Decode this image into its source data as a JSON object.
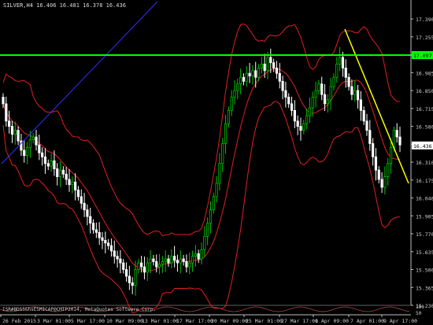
{
  "header": {
    "symbol_period": "SILVER,H4",
    "ohlc": "16.406 16.481 16.378 16.436"
  },
  "copyright": "ISR#BDS5&hsESMICAP@CMTP2014, MetaQuotes Software Corp.",
  "price_axis": {
    "ticks": [
      "17.390",
      "17.255",
      "17.120",
      "16.985",
      "16.850",
      "16.715",
      "16.580",
      "16.445",
      "16.310",
      "16.175",
      "16.040",
      "15.905",
      "15.770",
      "15.635",
      "15.500",
      "15.365",
      "15.230"
    ],
    "sub_ticks": [
      "100",
      "50"
    ],
    "current_price_label": "16.436",
    "green_level_label": "17.097"
  },
  "time_axis": {
    "ticks": [
      "26 Feb 2015",
      "3 Mar 01:00",
      "5 Mar 17:00",
      "10 Mar 09:00",
      "13 Mar 01:00",
      "17 Mar 17:00",
      "20 Mar 09:00",
      "25 Mar 01:00",
      "27 Mar 17:00",
      "1 Apr 09:00",
      "7 Apr 01:00",
      "9 Apr 17:00"
    ]
  },
  "colors": {
    "background": "#000000",
    "bull_candle": "#00c000",
    "bear_candle": "#ffffff",
    "bands": "#e02020",
    "trend_blue": "#3030ff",
    "trend_yellow": "#ffff00",
    "green_level": "#00ff00",
    "grid": "#1a3a1a",
    "axis_text": "#d0d0d0"
  },
  "chart_data": {
    "type": "candlestick",
    "symbol": "SILVER",
    "timeframe": "H4",
    "ylim": [
      15.23,
      17.45
    ],
    "green_level": 17.097,
    "current_price": 16.436,
    "indicator": "Bollinger Bands",
    "closes": [
      16.75,
      16.62,
      16.58,
      16.52,
      16.55,
      16.47,
      16.4,
      16.36,
      16.42,
      16.48,
      16.5,
      16.44,
      16.38,
      16.35,
      16.3,
      16.28,
      16.32,
      16.26,
      16.2,
      16.25,
      16.22,
      16.18,
      16.14,
      16.16,
      16.1,
      16.05,
      16.0,
      15.95,
      15.9,
      15.85,
      15.8,
      15.78,
      15.74,
      15.72,
      15.7,
      15.68,
      15.64,
      15.6,
      15.58,
      15.55,
      15.5,
      15.45,
      15.4,
      15.38,
      15.5,
      15.55,
      15.52,
      15.48,
      15.55,
      15.58,
      15.56,
      15.52,
      15.54,
      15.56,
      15.58,
      15.55,
      15.6,
      15.57,
      15.55,
      15.58,
      15.56,
      15.52,
      15.55,
      15.6,
      15.62,
      15.58,
      15.65,
      15.75,
      15.85,
      15.95,
      16.05,
      16.15,
      16.3,
      16.45,
      16.6,
      16.7,
      16.8,
      16.85,
      16.9,
      16.95,
      16.92,
      16.98,
      16.96,
      17.0,
      16.95,
      17.02,
      17.05,
      17.0,
      17.1,
      17.06,
      17.02,
      16.98,
      16.92,
      16.85,
      16.8,
      16.75,
      16.7,
      16.62,
      16.58,
      16.55,
      16.6,
      16.66,
      16.72,
      16.8,
      16.85,
      16.9,
      16.82,
      16.75,
      16.78,
      16.88,
      16.95,
      17.05,
      17.1,
      17.02,
      16.95,
      16.88,
      16.82,
      16.85,
      16.78,
      16.7,
      16.62,
      16.55,
      16.45,
      16.35,
      16.25,
      16.18,
      16.12,
      16.2,
      16.3,
      16.42,
      16.55,
      16.5,
      16.44
    ]
  }
}
